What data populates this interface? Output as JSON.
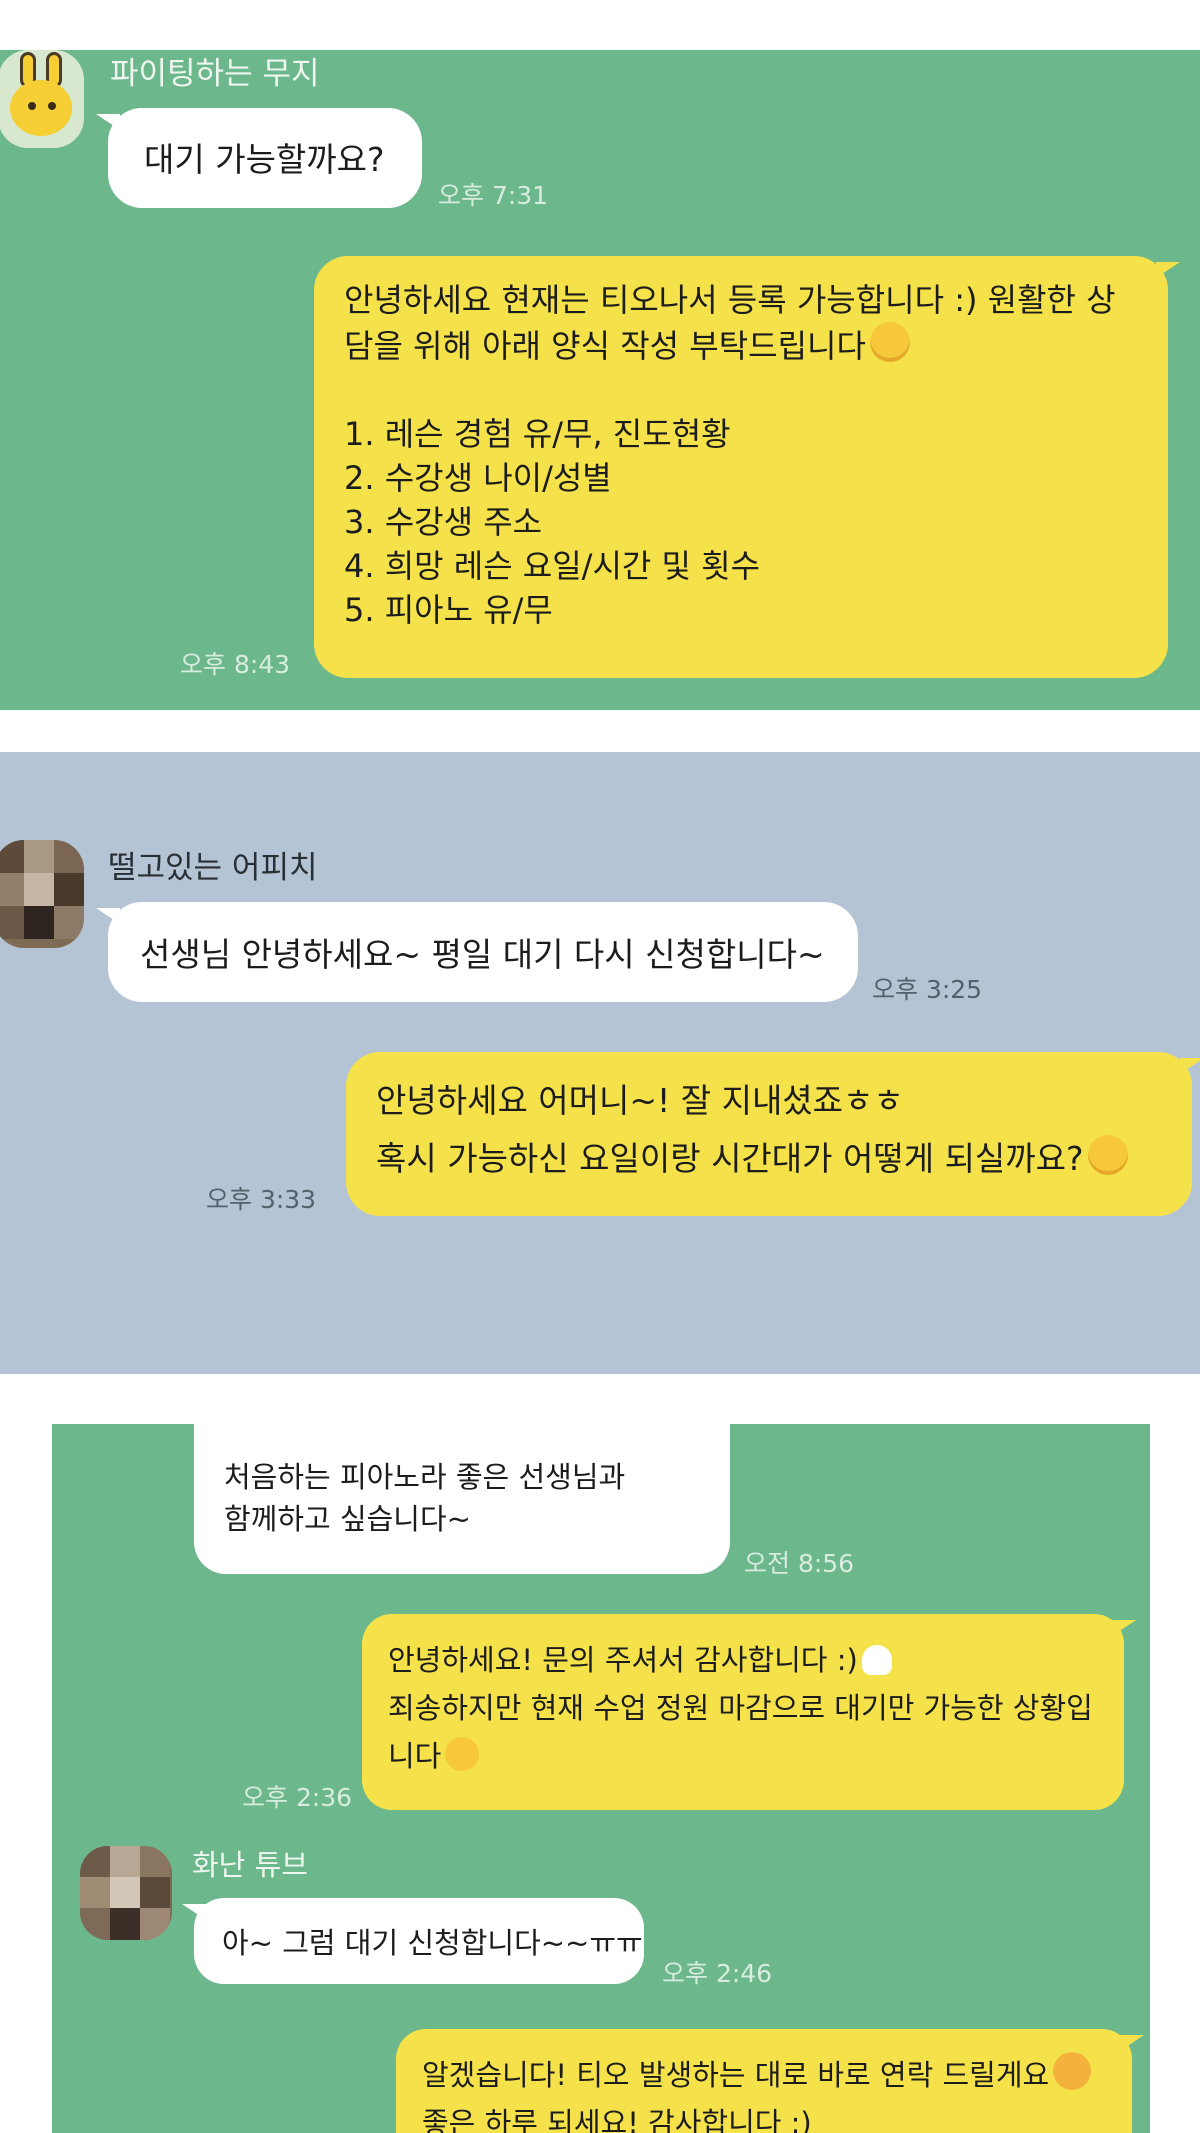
{
  "panel1": {
    "sender": "파이팅하는 무지",
    "incoming": {
      "text": "대기 가능할까요?",
      "time": "오후 7:31"
    },
    "outgoing": {
      "text": "안녕하세요 현재는 티오나서 등록 가능합니다 :) 원활한 상\n담을 위해 아래 양식 작성 부탁드립니다",
      "list": [
        "1. 레슨 경험 유/무, 진도현황",
        "2. 수강생 나이/성별",
        "3. 수강생 주소",
        "4. 희망 레슨 요일/시간 및 횟수",
        "5. 피아노 유/무"
      ],
      "time": "오후 8:43"
    }
  },
  "panel2": {
    "sender": "떨고있는 어피치",
    "incoming": {
      "text": "선생님 안녕하세요~ 평일 대기 다시 신청합니다~",
      "time": "오후 3:25"
    },
    "outgoing": {
      "line1": "안녕하세요 어머니~! 잘 지내셨죠ㅎㅎ",
      "line2": "혹시 가능하신 요일이랑 시간대가 어떻게 되실까요?",
      "time": "오후 3:33"
    }
  },
  "panel3": {
    "incoming1": {
      "text": "처음하는 피아노라 좋은 선생님과\n함께하고 싶습니다~",
      "time": "오전 8:56"
    },
    "outgoing1": {
      "line1": "안녕하세요! 문의 주셔서 감사합니다 :)",
      "line2": "죄송하지만 현재 수업 정원 마감으로 대기만 가능한 상황입",
      "line3": "니다",
      "time": "오후 2:36"
    },
    "sender": "화난 튜브",
    "incoming2": {
      "text": "아~ 그럼 대기 신청합니다~~ㅠㅠ",
      "time": "오후 2:46"
    },
    "outgoing2": {
      "line1": "알겠습니다! 티오 발생하는 대로 바로 연락 드릴게요",
      "line2": "좋은 하루 되세요! 감사합니다 :)"
    }
  },
  "colors": {
    "chat_green": "#6cb78c",
    "chat_blue": "#b4c4d4",
    "bubble_yellow": "#f5e24a",
    "bubble_white": "#ffffff"
  },
  "icons": [
    "muzi-avatar-icon",
    "apeach-avatar-blurred-icon",
    "tube-avatar-blurred-icon",
    "smiling-face-emoji",
    "white-heart-emoji",
    "crying-face-emoji",
    "smiling-face-with-hearts-emoji"
  ]
}
